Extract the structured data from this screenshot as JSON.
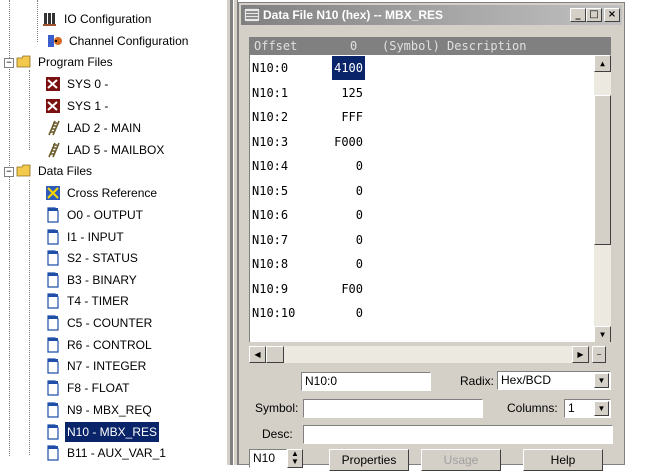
{
  "tree": {
    "items": [
      {
        "label": "IO Configuration",
        "icon": "io-config-icon"
      },
      {
        "label": "Channel Configuration",
        "icon": "channel-config-icon"
      },
      {
        "label": "Program Files",
        "icon": "folder-icon"
      },
      {
        "label": "SYS 0 -",
        "icon": "sys-file-icon"
      },
      {
        "label": "SYS 1 -",
        "icon": "sys-file-icon"
      },
      {
        "label": "LAD 2 - MAIN",
        "icon": "ladder-icon"
      },
      {
        "label": "LAD 5 - MAILBOX",
        "icon": "ladder-icon"
      },
      {
        "label": "Data Files",
        "icon": "folder-icon"
      },
      {
        "label": "Cross Reference",
        "icon": "cross-reference-icon"
      },
      {
        "label": "O0 - OUTPUT",
        "icon": "data-file-icon"
      },
      {
        "label": "I1 - INPUT",
        "icon": "data-file-icon"
      },
      {
        "label": "S2 - STATUS",
        "icon": "data-file-icon"
      },
      {
        "label": "B3 - BINARY",
        "icon": "data-file-icon"
      },
      {
        "label": "T4 - TIMER",
        "icon": "data-file-icon"
      },
      {
        "label": "C5 - COUNTER",
        "icon": "data-file-icon"
      },
      {
        "label": "R6 - CONTROL",
        "icon": "data-file-icon"
      },
      {
        "label": "N7 - INTEGER",
        "icon": "data-file-icon"
      },
      {
        "label": "F8 - FLOAT",
        "icon": "data-file-icon"
      },
      {
        "label": "N9 - MBX_REQ",
        "icon": "data-file-icon"
      },
      {
        "label": "N10 - MBX_RES",
        "icon": "data-file-icon",
        "selected": true
      },
      {
        "label": "B11 - AUX_VAR_1",
        "icon": "data-file-icon"
      }
    ]
  },
  "window": {
    "title": "Data File N10 (hex)  --  MBX_RES",
    "minimize": "_",
    "maximize": "□",
    "close": "×"
  },
  "grid": {
    "header_offset": "Offset",
    "header_col": "0",
    "header_desc": "(Symbol) Description",
    "rows": [
      {
        "addr": "N10:0",
        "value": "4100",
        "selected": true
      },
      {
        "addr": "N10:1",
        "value": "125"
      },
      {
        "addr": "N10:2",
        "value": "FFF"
      },
      {
        "addr": "N10:3",
        "value": "F000"
      },
      {
        "addr": "N10:4",
        "value": "0"
      },
      {
        "addr": "N10:5",
        "value": "0"
      },
      {
        "addr": "N10:6",
        "value": "0"
      },
      {
        "addr": "N10:7",
        "value": "0"
      },
      {
        "addr": "N10:8",
        "value": "0"
      },
      {
        "addr": "N10:9",
        "value": "F00"
      },
      {
        "addr": "N10:10",
        "value": "0"
      }
    ]
  },
  "form": {
    "address_value": "N10:0",
    "radix_label": "Radix:",
    "radix_value": "Hex/BCD",
    "symbol_label": "Symbol:",
    "symbol_value": "",
    "columns_label": "Columns:",
    "columns_value": "1",
    "desc_label": "Desc:",
    "desc_value": "",
    "file_value": "N10",
    "properties_button": "Properties",
    "usage_button": "Usage",
    "help_button": "Help"
  },
  "colors": {
    "selection": "#0a246a",
    "titlebar_inactive": "#808080",
    "face": "#d4d0c8"
  }
}
